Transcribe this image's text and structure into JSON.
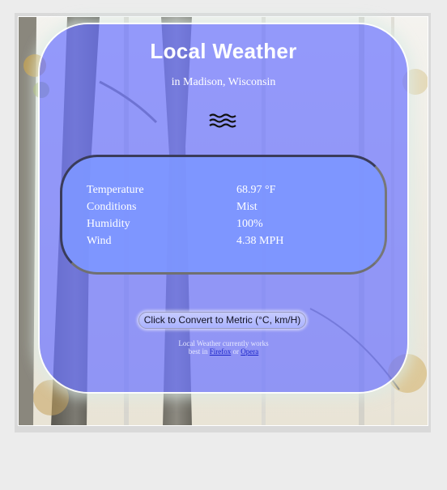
{
  "header": {
    "title": "Local Weather",
    "location": "in Madison, Wisconsin"
  },
  "condition_icon": "mist-icon",
  "readings": [
    {
      "label": "Temperature",
      "value": "68.97 °F"
    },
    {
      "label": "Conditions",
      "value": "Mist"
    },
    {
      "label": "Humidity",
      "value": "100%"
    },
    {
      "label": "Wind",
      "value": "4.38 MPH"
    }
  ],
  "convert_button": {
    "label": "Click to Convert to Metric (°C, km/H)"
  },
  "footer": {
    "line1": "Local Weather currently works",
    "line2_prefix": "best in",
    "link_firefox": "Firefox",
    "connector": "or",
    "link_opera": "Opera"
  },
  "colors": {
    "card_fill": "#6e76ff",
    "panel_fill": "#7d96ff",
    "text": "#ffffff",
    "link": "#1a24c8"
  }
}
